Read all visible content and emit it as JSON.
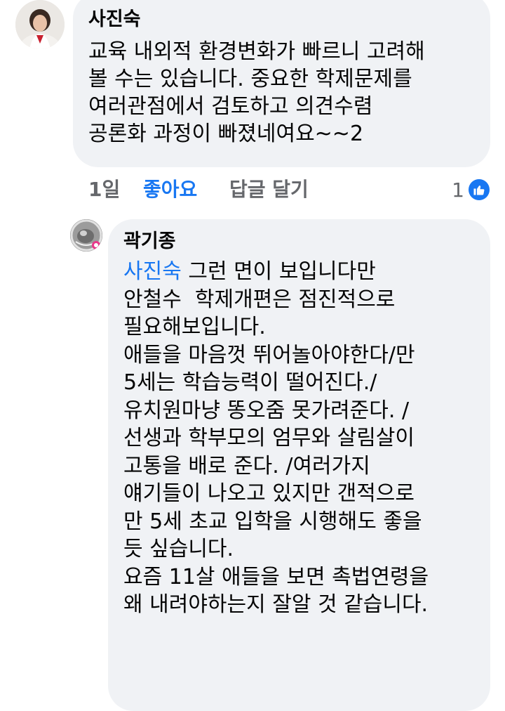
{
  "comments": [
    {
      "author": "사진숙",
      "text": "교육 내외적 환경변화가 빠르니 고려해\n볼 수는 있습니다. 중요한 학제문제를\n여러관점에서 검토하고 의견수렴\n공론화 과정이 빠졌네여요~~2",
      "time": "1일",
      "like_label": "좋아요",
      "reply_label": "답글 달기",
      "reaction_count": "1",
      "reaction_icon": "thumbs-up-icon",
      "like_color": "#1877f2"
    },
    {
      "author": "곽기종",
      "mention": "사진숙",
      "first_line_rest": " 그런 면이 보입니다만",
      "lines": [
        "안철수  학제개편은 점진적으로",
        "필요해보입니다.",
        "애들을 마음껏 뛰어놀아야한다/만",
        "5세는 학습능력이 떨어진다./",
        "유치원마냥 똥오줌 못가려준다. /",
        "선생과 학부모의 엄무와 살림살이",
        "고통을 배로 준다. /여러가지",
        "얘기들이 나오고 있지만 갠적으로",
        "만 5세 초교 입학을 시행해도 좋을",
        "듯 싶습니다.",
        "요즘 11살 애들을 보면 촉법연령을",
        "왜 내려야하는지 잘알 것 같습니다."
      ]
    }
  ]
}
